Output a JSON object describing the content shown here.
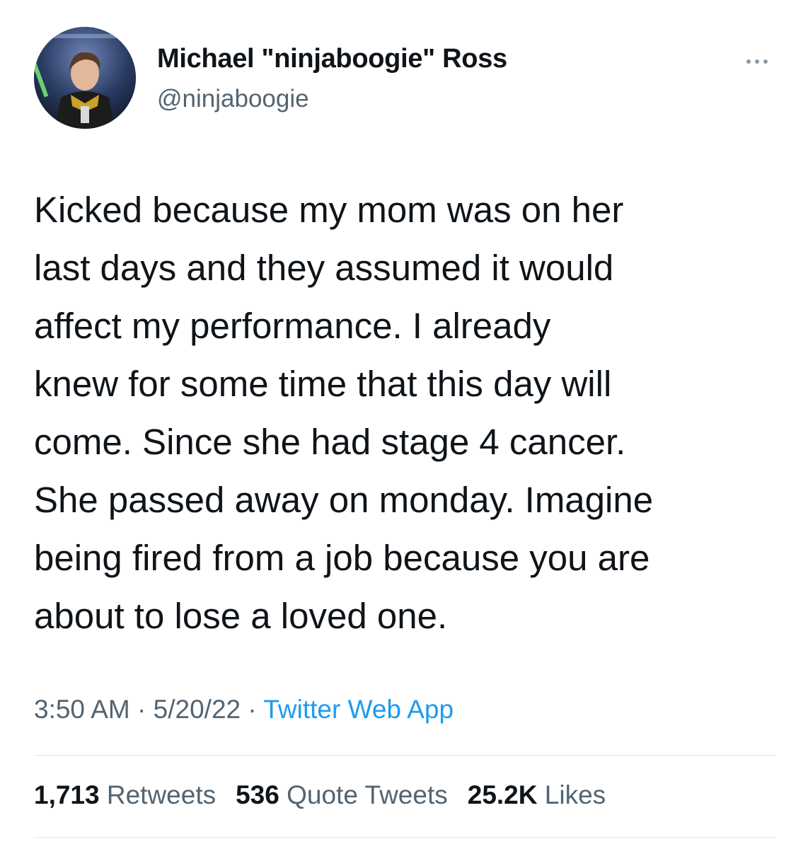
{
  "author": {
    "display_name": "Michael \"ninjaboogie\" Ross",
    "handle": "@ninjaboogie",
    "avatar_icon": "profile-photo"
  },
  "more_icon": "more-horizontal-icon",
  "tweet": {
    "lines": [
      "Kicked because my mom was on her",
      "last days and they assumed it would",
      "affect my performance. I already",
      "knew for some time that this day will",
      "come. Since she had stage 4 cancer.",
      "She passed away on monday. Imagine",
      "being fired from a job because you are",
      "about to lose a loved one."
    ]
  },
  "meta": {
    "time": "3:50 AM",
    "separator": " · ",
    "date": "5/20/22",
    "source": "Twitter Web App"
  },
  "stats": {
    "retweets_count": "1,713",
    "retweets_label": "Retweets",
    "quotes_count": "536",
    "quotes_label": "Quote Tweets",
    "likes_count": "25.2K",
    "likes_label": "Likes"
  },
  "colors": {
    "text": "#0f1419",
    "secondary": "#536471",
    "link": "#1d9bf0",
    "divider": "#e1e6ea"
  }
}
